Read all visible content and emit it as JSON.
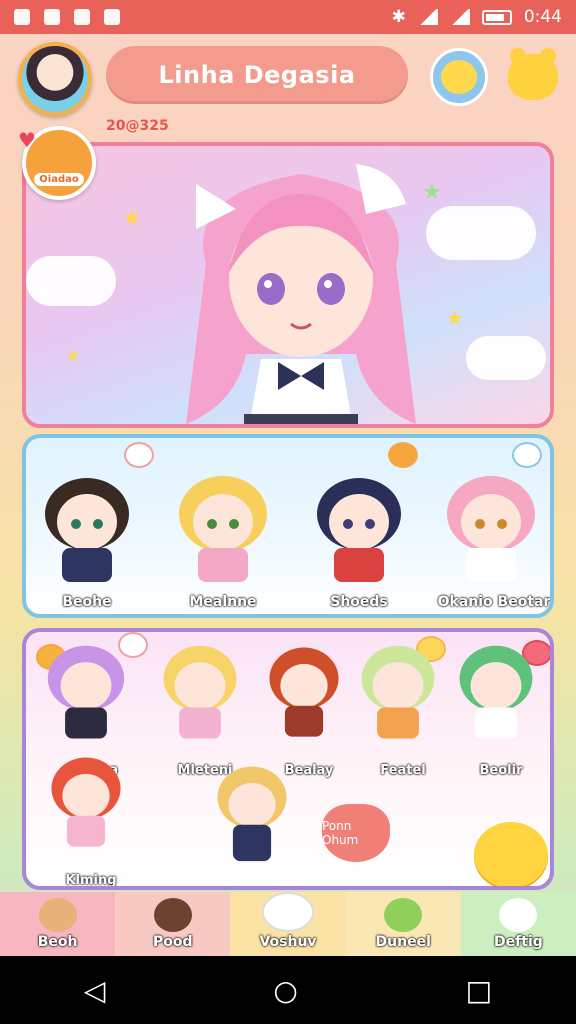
{
  "status_bar": {
    "time": "0:44"
  },
  "header": {
    "title": "Linha Degasia"
  },
  "subtitle": "20@325",
  "badge": {
    "label": "Oiadao"
  },
  "roster": {
    "characters": [
      {
        "name": "Beohe",
        "hair": "#3a2a24",
        "outfit": "#2e3560"
      },
      {
        "name": "Mealnne",
        "hair": "#f7cf5a",
        "outfit": "#f5a7c6"
      },
      {
        "name": "Shoeds",
        "hair": "#2a2e58",
        "outfit": "#d9423f"
      },
      {
        "name": "Okanio Beotar",
        "hair": "#f6a7c2",
        "outfit": "#ffffff"
      }
    ]
  },
  "gallery": {
    "characters": [
      {
        "name": "Cienlaa",
        "hair": "#c894e8",
        "outfit": "#2d2b3f"
      },
      {
        "name": "Mleteni",
        "hair": "#f7d36a",
        "outfit": "#f3b1d0"
      },
      {
        "name": "Bealay",
        "hair": "#cf4f2a",
        "outfit": "#9e3a2c"
      },
      {
        "name": "Featel",
        "hair": "#cde79a",
        "outfit": "#f2a24d"
      },
      {
        "name": "Beolir",
        "hair": "#5ec27c",
        "outfit": "#ffffff"
      },
      {
        "name": "Klming",
        "hair": "#e8553c",
        "outfit": "#f6b5cf"
      },
      {
        "name": "",
        "hair": "#f2c76a",
        "outfit": "#2e3560"
      }
    ],
    "heart_note": "Ponn Ohum"
  },
  "nav": {
    "items": [
      {
        "label": "Beoh",
        "color": "#e7b17a"
      },
      {
        "label": "Pood",
        "color": "#6b4330"
      },
      {
        "label": "Voshuv",
        "color": "#ffffff"
      },
      {
        "label": "Duneel",
        "color": "#8fd05a"
      },
      {
        "label": "Deftig",
        "color": "#ffffff"
      }
    ]
  },
  "colors": {
    "status_bar": "#e8625a",
    "title_pill": "#f39b8d",
    "hero_border": "#ef7f9a",
    "roster_border": "#7fc5e3",
    "gallery_border": "#a985d8"
  }
}
